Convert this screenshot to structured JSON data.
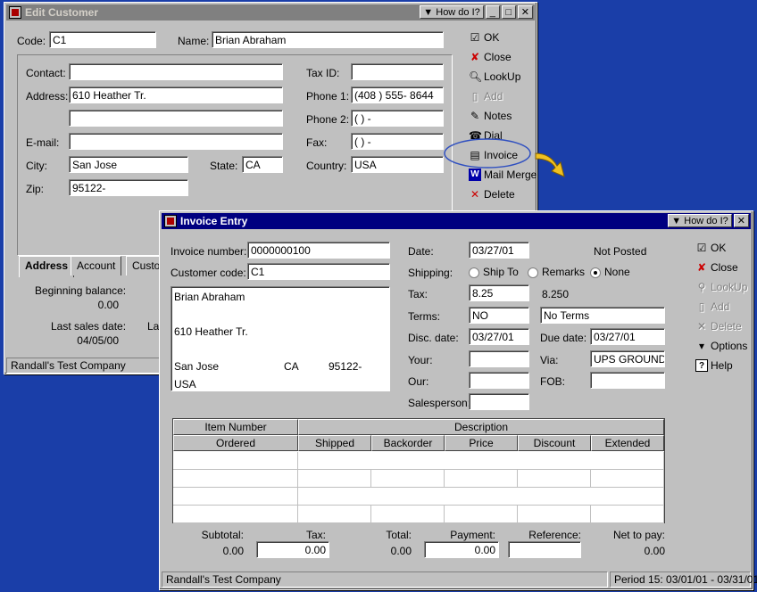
{
  "edit_customer": {
    "title": "Edit Customer",
    "how_do_i": "How do I?",
    "code_label": "Code:",
    "code_value": "C1",
    "name_label": "Name:",
    "name_value": "Brian Abraham",
    "contact_label": "Contact:",
    "contact_value": "",
    "address_label": "Address:",
    "address1": "610 Heather Tr.",
    "address2": "",
    "email_label": "E-mail:",
    "email_value": "",
    "city_label": "City:",
    "city_value": "San Jose",
    "state_label": "State:",
    "state_value": "CA",
    "zip_label": "Zip:",
    "zip_value": "95122-",
    "taxid_label": "Tax ID:",
    "taxid_value": "",
    "phone1_label": "Phone 1:",
    "phone1_value": "(408 ) 555- 8644",
    "phone2_label": "Phone 2:",
    "phone2_value": "(      )        -",
    "fax_label": "Fax:",
    "fax_value": "(      )        -",
    "country_label": "Country:",
    "country_value": "USA",
    "tabs": [
      "Address",
      "Account",
      "Custom"
    ],
    "beginning_balance_label": "Beginning balance:",
    "beginning_balance_value": "0.00",
    "last_sales_date_label": "Last sales date:",
    "last_sales_date_value": "04/05/00",
    "la_label": "La",
    "status": "Randall's Test Company",
    "buttons": {
      "ok": "OK",
      "close": "Close",
      "lookup": "LookUp",
      "add": "Add",
      "notes": "Notes",
      "dial": "Dial",
      "invoice": "Invoice",
      "mail_merge": "Mail Merge",
      "delete": "Delete"
    }
  },
  "invoice_entry": {
    "title": "Invoice Entry",
    "how_do_i": "How do I?",
    "invoice_number_label": "Invoice number:",
    "invoice_number_value": "0000000100",
    "customer_code_label": "Customer code:",
    "customer_code_value": "C1",
    "address_lines": {
      "name": "Brian Abraham",
      "street": "610 Heather Tr.",
      "city": "San Jose",
      "state": "CA",
      "zip": "95122-",
      "country": "USA"
    },
    "date_label": "Date:",
    "date_value": "03/27/01",
    "posted_status": "Not Posted",
    "shipping_label": "Shipping:",
    "shipping_options": [
      "Ship To",
      "Remarks",
      "None"
    ],
    "shipping_selected": "None",
    "tax_label": "Tax:",
    "tax_value": "8.25",
    "tax_display": "8.250",
    "terms_label": "Terms:",
    "terms_code": "NO",
    "terms_desc": "No Terms",
    "disc_date_label": "Disc. date:",
    "disc_date_value": "03/27/01",
    "due_date_label": "Due date:",
    "due_date_value": "03/27/01",
    "your_label": "Your:",
    "your_value": "",
    "via_label": "Via:",
    "via_value": "UPS GROUND",
    "our_label": "Our:",
    "our_value": "",
    "fob_label": "FOB:",
    "fob_value": "",
    "salesperson_label": "Salesperson:",
    "salesperson_value": "",
    "grid_headers_top": [
      "Item Number",
      "Description"
    ],
    "grid_headers_bottom": [
      "Ordered",
      "Shipped",
      "Backorder",
      "Price",
      "Discount",
      "Extended"
    ],
    "totals": {
      "subtotal_label": "Subtotal:",
      "subtotal_value": "0.00",
      "tax_label": "Tax:",
      "tax_value": "0.00",
      "total_label": "Total:",
      "total_value": "0.00",
      "payment_label": "Payment:",
      "payment_value": "0.00",
      "reference_label": "Reference:",
      "reference_value": "",
      "net_label": "Net to pay:",
      "net_value": "0.00"
    },
    "status_company": "Randall's Test Company",
    "status_period": "Period 15: 03/01/01 - 03/31/01",
    "buttons": {
      "ok": "OK",
      "close": "Close",
      "lookup": "LookUp",
      "add": "Add",
      "delete": "Delete",
      "options": "Options",
      "help": "Help"
    }
  }
}
